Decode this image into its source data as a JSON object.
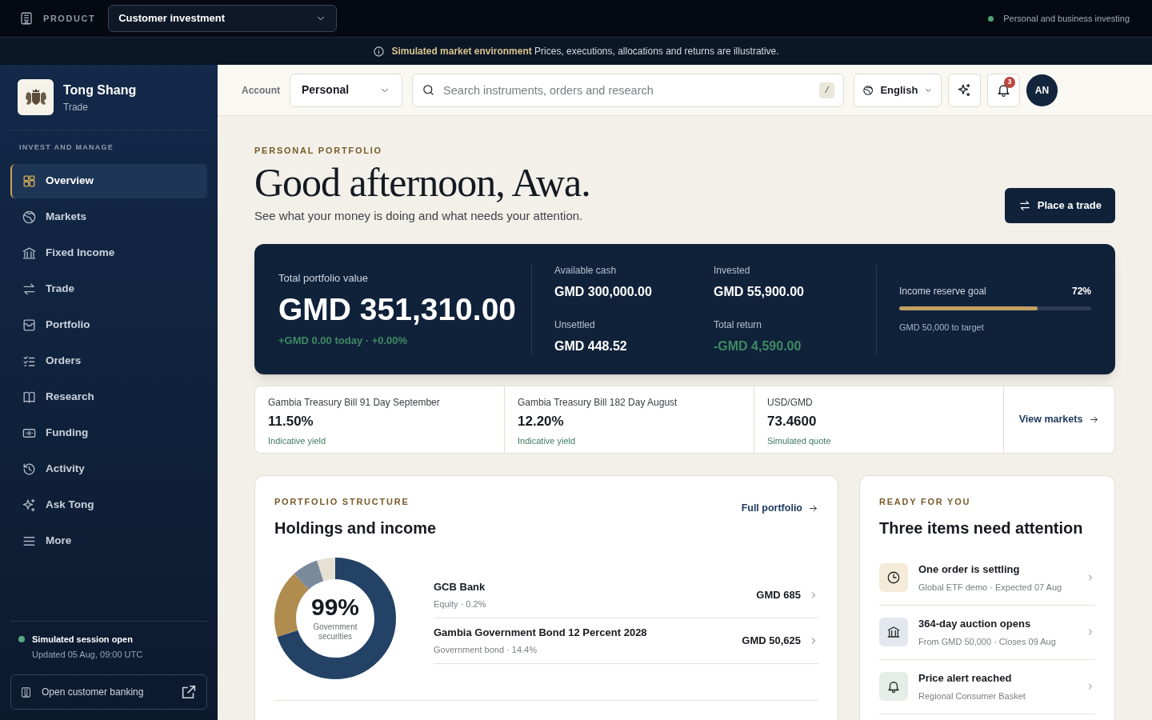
{
  "topbar": {
    "product_label": "PRODUCT",
    "product_select": "Customer investment",
    "status": "Personal and business investing"
  },
  "banner": {
    "text": "**Simulated market environment** Prices, executions, allocations and returns are illustrative."
  },
  "sidebar": {
    "brand": "Tong Shang",
    "subtitle": "Trade",
    "section": "INVEST AND MANAGE",
    "items": [
      {
        "label": "Overview",
        "selected": true
      },
      {
        "label": "Markets",
        "selected": false
      },
      {
        "label": "Fixed Income",
        "selected": false
      },
      {
        "label": "Trade",
        "selected": false
      },
      {
        "label": "Portfolio",
        "selected": false
      },
      {
        "label": "Orders",
        "selected": false
      },
      {
        "label": "Research",
        "selected": false
      },
      {
        "label": "Funding",
        "selected": false
      },
      {
        "label": "Activity",
        "selected": false
      },
      {
        "label": "Ask Tong",
        "selected": false
      },
      {
        "label": "More",
        "selected": false
      }
    ],
    "session_title": "Simulated session open",
    "session_updated": "Updated 05 Aug, 09:00 UTC",
    "banking_link": "Open customer banking"
  },
  "header": {
    "account_label": "Account",
    "account_select": "Personal",
    "search_placeholder": "Search instruments, orders and research",
    "search_shortcut": "/",
    "language": "English",
    "notification_count": "3",
    "avatar": "AN"
  },
  "hero": {
    "eyebrow": "PERSONAL PORTFOLIO",
    "title": "Good afternoon, Awa.",
    "subtitle": "See what your money is doing and what needs your attention.",
    "action": "Place a trade"
  },
  "summary": {
    "total_label": "Total portfolio value",
    "total_value": "GMD 351,310.00",
    "today": "+GMD 0.00 today · +0.00%",
    "stats": [
      {
        "label": "Available cash",
        "value": "GMD 300,000.00",
        "kind": "plain"
      },
      {
        "label": "Invested",
        "value": "GMD 55,900.00",
        "kind": "plain"
      },
      {
        "label": "Unsettled",
        "value": "GMD 448.52",
        "kind": "plain"
      },
      {
        "label": "Total return",
        "value": "-GMD 4,590.00",
        "kind": "change"
      }
    ],
    "goal": {
      "label": "Income reserve goal",
      "percent": "72%",
      "level": 0.72,
      "note": "GMD 50,000 to target"
    }
  },
  "quotes": [
    {
      "name": "Gambia Treasury Bill 91 Day September",
      "value": "11.50%",
      "note": "Indicative yield"
    },
    {
      "name": "Gambia Treasury Bill 182 Day August",
      "value": "12.20%",
      "note": "Indicative yield"
    },
    {
      "name": "USD/GMD",
      "value": "73.4600",
      "note": "Simulated quote"
    }
  ],
  "quotes_link": "View markets",
  "holdings": {
    "eyebrow": "PORTFOLIO STRUCTURE",
    "title": "Holdings and income",
    "link": "Full portfolio",
    "donut_value": "99%",
    "donut_label": "Government securities",
    "rows": [
      {
        "name": "GCB Bank",
        "detail": "Equity · 0.2%",
        "value": "GMD 685"
      },
      {
        "name": "Gambia Government Bond 12 Percent 2028",
        "detail": "Government bond · 14.4%",
        "value": "GMD 50,625"
      }
    ]
  },
  "attention": {
    "eyebrow": "READY FOR YOU",
    "title": "Three items need attention",
    "items": [
      {
        "title": "One order is settling",
        "detail": "Global ETF demo · Expected 07 Aug"
      },
      {
        "title": "364-day auction opens",
        "detail": "From GMD 50,000 · Closes 09 Aug"
      },
      {
        "title": "Price alert reached",
        "detail": "Regional Consumer Basket"
      }
    ]
  }
}
